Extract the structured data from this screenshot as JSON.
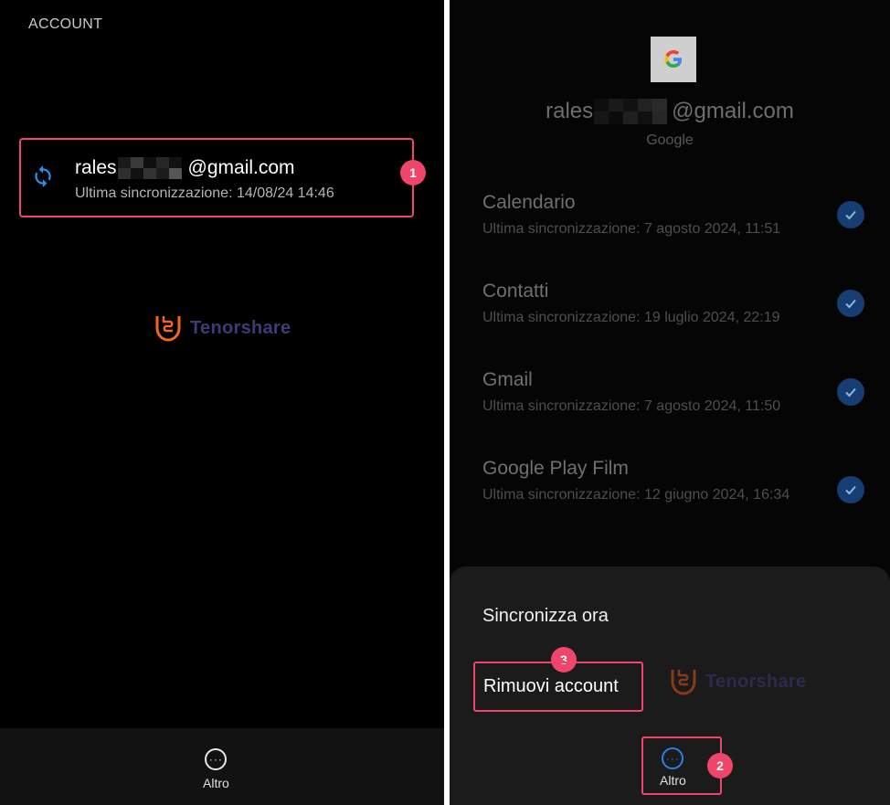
{
  "left": {
    "title": "ACCOUNT",
    "account": {
      "email_prefix": "rales",
      "email_suffix": "@gmail.com",
      "last_sync": "Ultima sincronizzazione: 14/08/24 14:46"
    },
    "badge": "1",
    "watermark": "Tenorshare",
    "bottom_more_label": "Altro"
  },
  "right": {
    "email_prefix": "rales",
    "email_suffix": "@gmail.com",
    "provider": "Google",
    "sync_items": [
      {
        "name": "Calendario",
        "time": "Ultima sincronizzazione: 7 agosto 2024, 11:51"
      },
      {
        "name": "Contatti",
        "time": "Ultima sincronizzazione: 19 luglio 2024, 22:19"
      },
      {
        "name": "Gmail",
        "time": "Ultima sincronizzazione: 7 agosto 2024, 11:50"
      },
      {
        "name": "Google Play Film",
        "time": "Ultima sincronizzazione: 12 giugno 2024, 16:34"
      }
    ],
    "sheet": {
      "sync_now": "Sincronizza ora",
      "remove_account": "Rimuovi account",
      "more_label": "Altro"
    },
    "badge_more": "2",
    "badge_remove": "3",
    "watermark": "Tenorshare"
  },
  "colors": {
    "highlight": "#f0456a",
    "sync_icon": "#2196f3",
    "check": "#173e73",
    "brand_orange": "#f26522",
    "brand_text": "#3e3a78"
  }
}
